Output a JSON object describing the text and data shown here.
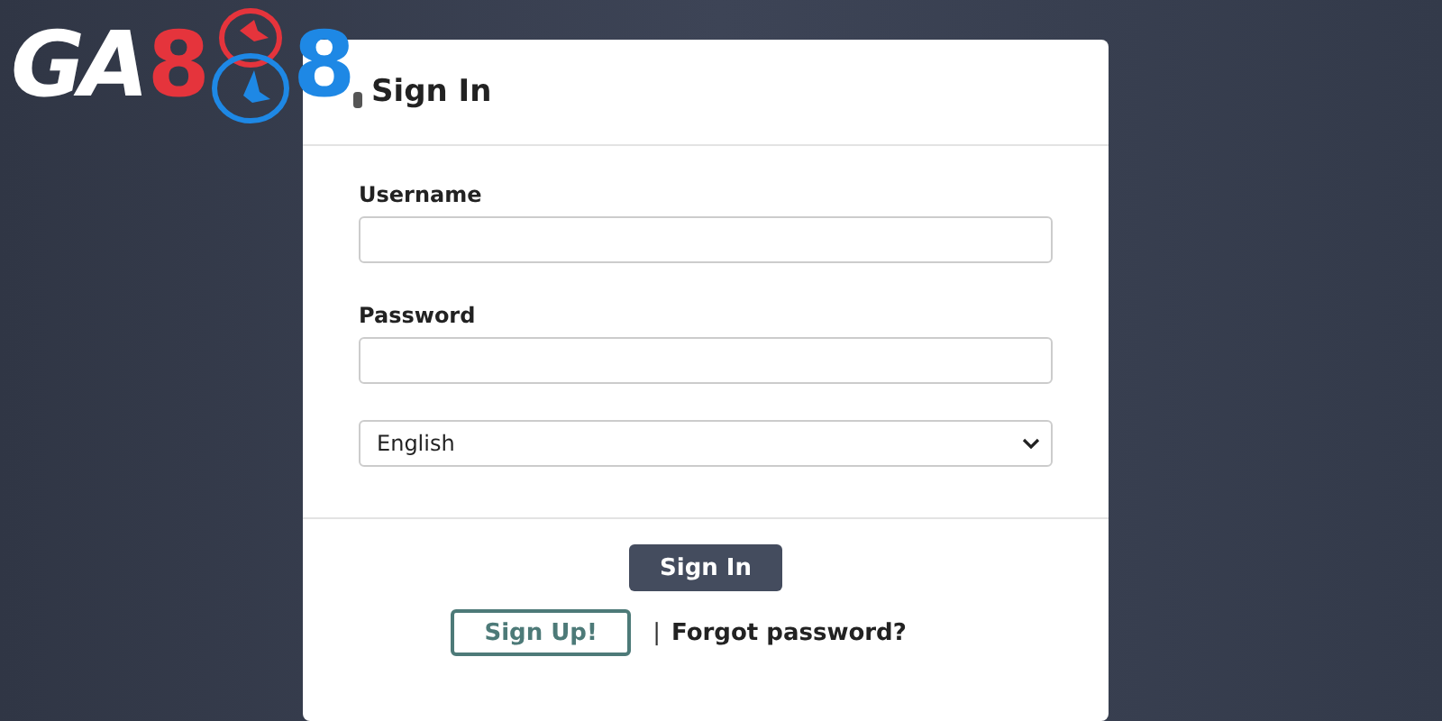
{
  "logo": {
    "letters": "GA",
    "left_digit": "8",
    "right_digit": "8"
  },
  "card": {
    "title": "Sign In",
    "fields": [
      {
        "label": "Username"
      },
      {
        "label": "Password"
      }
    ],
    "language": {
      "value": "English"
    },
    "sign_in_button": "Sign In",
    "sign_up_button": "Sign Up!",
    "separator": "|",
    "forgot_link": "Forgot password?"
  }
}
